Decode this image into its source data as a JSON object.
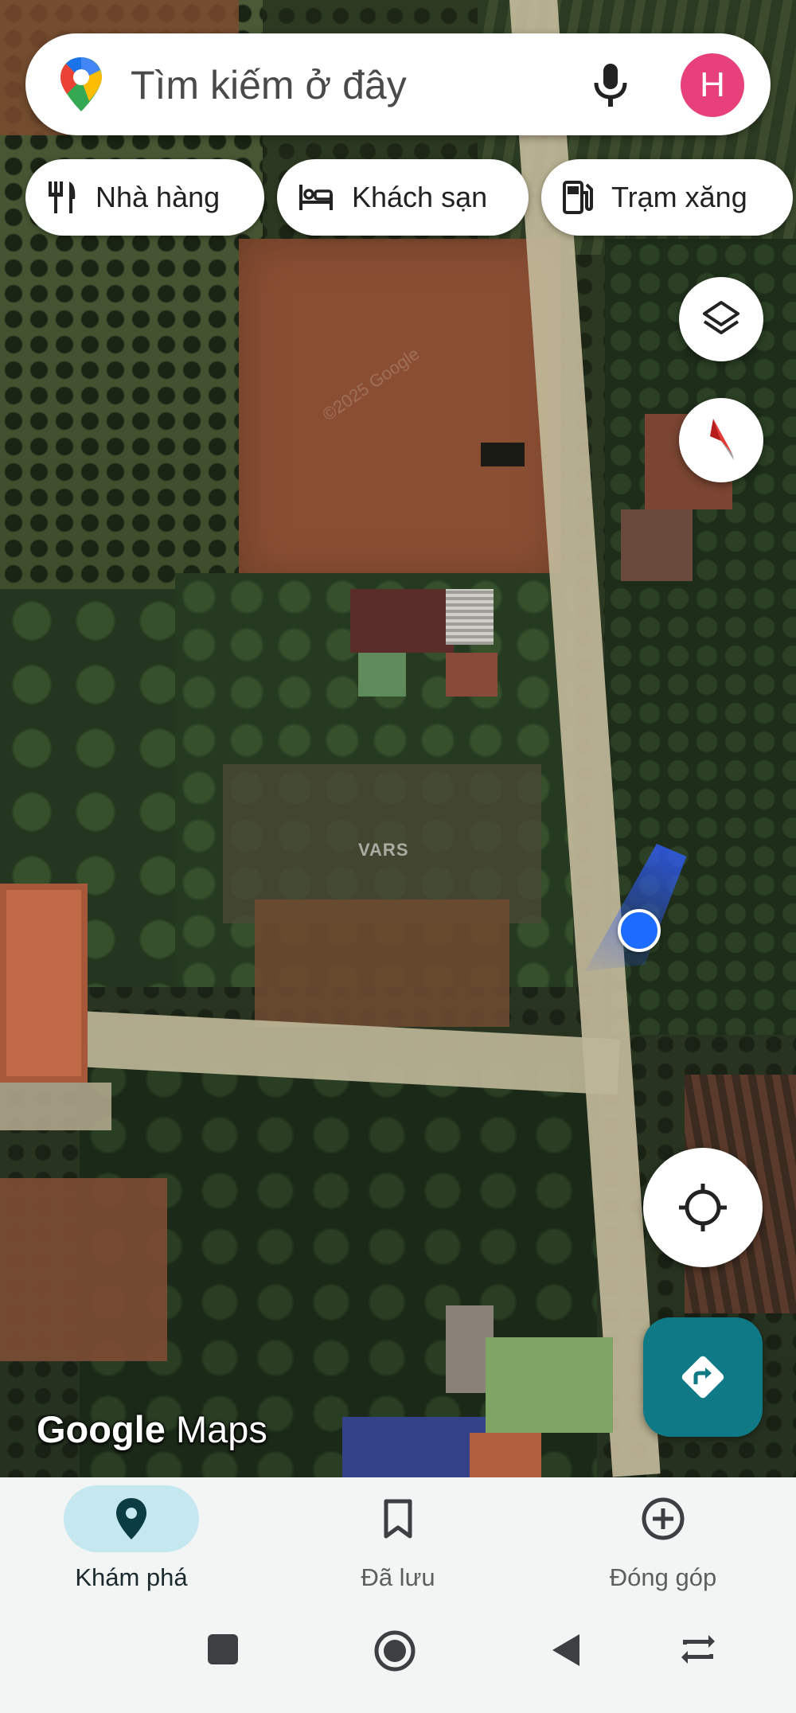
{
  "search": {
    "placeholder": "Tìm kiếm ở đây",
    "avatar_letter": "H"
  },
  "chips": [
    {
      "label": "Nhà hàng",
      "icon": "restaurant-icon"
    },
    {
      "label": "Khách sạn",
      "icon": "hotel-icon"
    },
    {
      "label": "Trạm xăng",
      "icon": "gas-station-icon"
    }
  ],
  "map": {
    "logo_google": "Google",
    "logo_maps": "Maps",
    "watermark": "VARS",
    "imagery_credit": "©2025 Google"
  },
  "buttons": {
    "layers": "layers-icon",
    "compass": "compass-icon",
    "my_location": "my-location-icon",
    "directions": "directions-icon"
  },
  "bottom_nav": [
    {
      "label": "Khám phá",
      "icon": "explore-pin-icon",
      "active": true
    },
    {
      "label": "Đã lưu",
      "icon": "bookmark-icon",
      "active": false
    },
    {
      "label": "Đóng góp",
      "icon": "add-circle-icon",
      "active": false
    }
  ],
  "colors": {
    "avatar": "#e8407a",
    "directions_button": "#0f7a86",
    "location_dot": "#1d6bff",
    "active_nav_pill": "#c5e7ef"
  }
}
